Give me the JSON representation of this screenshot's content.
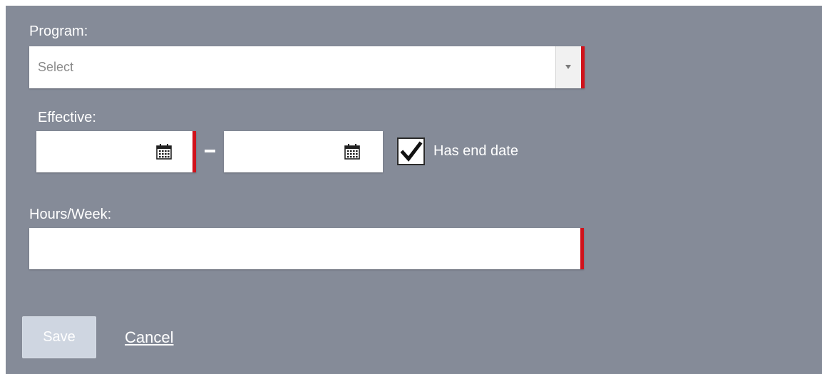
{
  "form": {
    "program": {
      "label": "Program:",
      "placeholder": "Select",
      "arrow_icon": "chevron-down-icon"
    },
    "effective": {
      "label": "Effective:",
      "start_date": "",
      "end_date": "",
      "separator": "–",
      "calendar_icon": "calendar-icon"
    },
    "has_end_date": {
      "label": "Has end date",
      "checked": true
    },
    "hours_week": {
      "label": "Hours/Week:",
      "value": ""
    },
    "actions": {
      "save_label": "Save",
      "save_enabled": false,
      "cancel_label": "Cancel"
    }
  },
  "colors": {
    "panel_background": "#858b98",
    "required_indicator": "#d0121b",
    "save_button_disabled": "#cfd6e1",
    "text": "#ffffff"
  }
}
